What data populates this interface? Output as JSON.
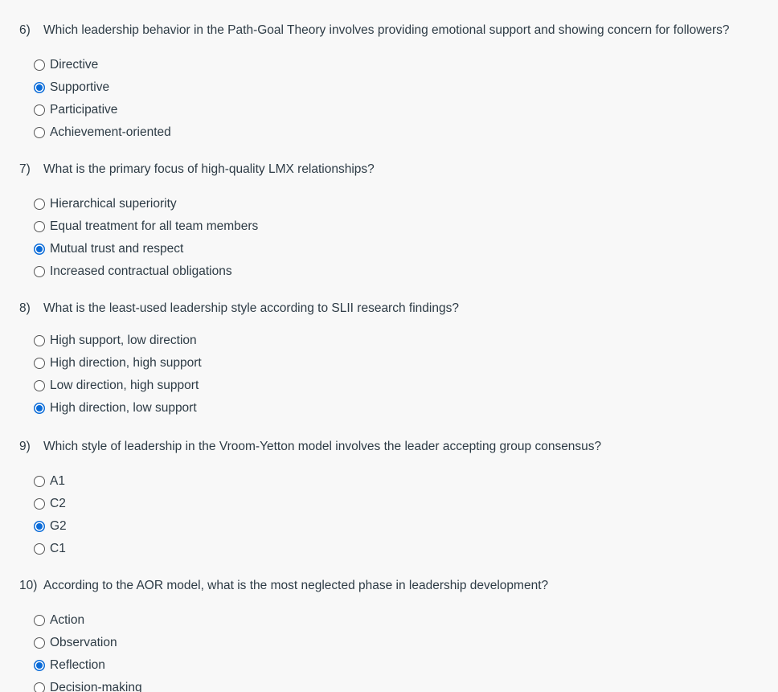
{
  "questions": [
    {
      "number": "6)",
      "text": "Which leadership behavior in the Path-Goal Theory involves providing emotional support and showing concern for followers?",
      "options": [
        {
          "label": "Directive",
          "selected": false
        },
        {
          "label": "Supportive",
          "selected": true
        },
        {
          "label": "Participative",
          "selected": false
        },
        {
          "label": "Achievement-oriented",
          "selected": false
        }
      ]
    },
    {
      "number": "7)",
      "text": "What is the primary focus of high-quality LMX relationships?",
      "options": [
        {
          "label": "Hierarchical superiority",
          "selected": false
        },
        {
          "label": "Equal treatment for all team members",
          "selected": false
        },
        {
          "label": "Mutual trust and respect",
          "selected": true
        },
        {
          "label": "Increased contractual obligations",
          "selected": false
        }
      ]
    },
    {
      "number": "8)",
      "text": "What is the least-used leadership style according to SLII research findings?",
      "options": [
        {
          "label": "High support, low direction",
          "selected": false
        },
        {
          "label": "High direction, high support",
          "selected": false
        },
        {
          "label": "Low direction, high support",
          "selected": false
        },
        {
          "label": "High direction, low support",
          "selected": true
        }
      ]
    },
    {
      "number": "9)",
      "text": "Which style of leadership in the Vroom-Yetton model involves the leader accepting group consensus?",
      "options": [
        {
          "label": "A1",
          "selected": false
        },
        {
          "label": "C2",
          "selected": false
        },
        {
          "label": "G2",
          "selected": true
        },
        {
          "label": "C1",
          "selected": false
        }
      ]
    },
    {
      "number": "10)",
      "text": "According to the AOR model, what is the most neglected phase in leadership development?",
      "options": [
        {
          "label": "Action",
          "selected": false
        },
        {
          "label": "Observation",
          "selected": false
        },
        {
          "label": "Reflection",
          "selected": true
        },
        {
          "label": "Decision-making",
          "selected": false
        }
      ]
    }
  ],
  "colors": {
    "accent": "#0a6bd8",
    "text": "#2d3b45",
    "background": "#f8f8f8"
  }
}
